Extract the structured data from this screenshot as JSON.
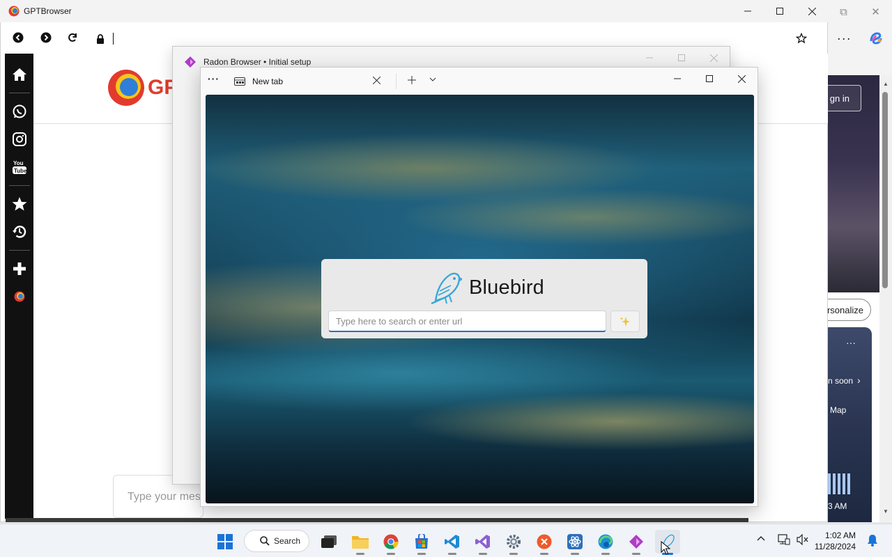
{
  "gpt_browser": {
    "title": "GPTBrowser",
    "header_logo_text": "GP",
    "chat_placeholder": "Type your mes"
  },
  "background_window": {
    "signin_label": "gn in",
    "personalize_label": "rsonalize",
    "coming_soon_label": "n soon",
    "map_label": "Map",
    "time_label": "3 AM",
    "menu_label": "···"
  },
  "radon": {
    "title": "Radon Browser • Initial setup"
  },
  "bluebird": {
    "tab_label": "New tab",
    "brand": "Bluebird",
    "search_placeholder": "Type here to search or enter url",
    "menu_label": "···"
  },
  "taskbar": {
    "search_label": "Search",
    "time": "1:02 AM",
    "date": "11/28/2024"
  },
  "colors": {
    "accent": "#2a6fbf",
    "sidebar": "#111111",
    "radon_icon": "#b03cc8",
    "bluebird_icon": "#3aa7d8"
  }
}
